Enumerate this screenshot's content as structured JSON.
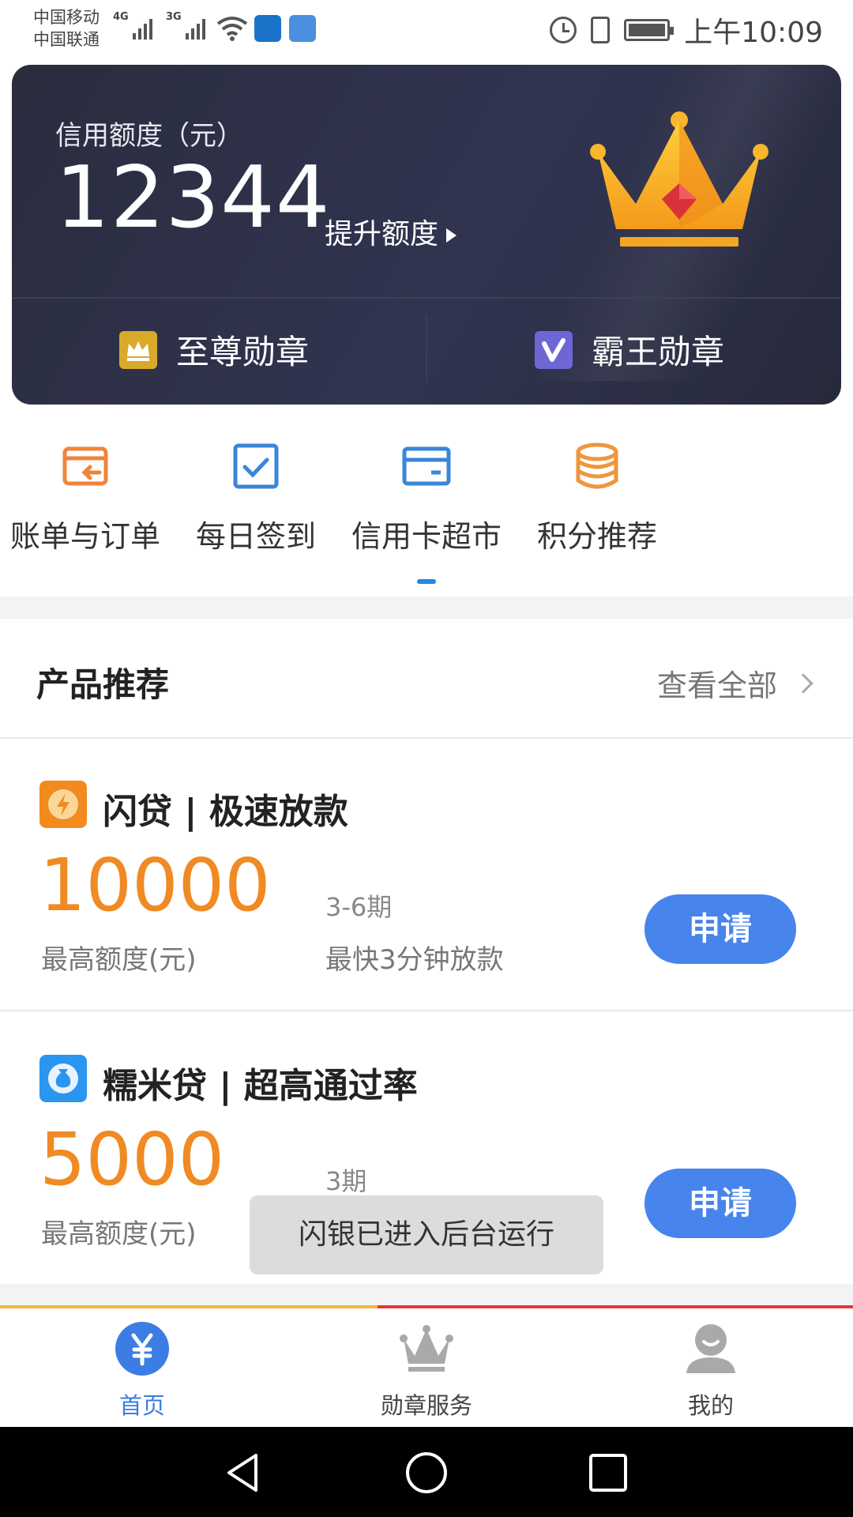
{
  "status_bar": {
    "carrier_1": "中国移动",
    "carrier_2": "中国联通",
    "sim1_network": "4G",
    "sim2_network": "3G",
    "time": "上午10:09"
  },
  "credit_card": {
    "label": "信用额度（元）",
    "amount": "12344",
    "raise_label": "提升额度",
    "badges": [
      {
        "label": "至尊勋章",
        "icon": "crown-badge-icon",
        "color": "#d9a92a"
      },
      {
        "label": "霸王勋章",
        "icon": "v-badge-icon",
        "color": "#6f66d6"
      }
    ]
  },
  "quick_tabs": [
    {
      "label": "账单与订单",
      "icon": "bill-order-icon",
      "color": "#f0843c"
    },
    {
      "label": "每日签到",
      "icon": "checkin-icon",
      "color": "#3a86d8"
    },
    {
      "label": "信用卡超市",
      "icon": "credit-card-icon",
      "color": "#3a86d8"
    },
    {
      "label": "积分推荐",
      "icon": "coins-icon",
      "color": "#f0963c"
    }
  ],
  "products": {
    "title": "产品推荐",
    "view_all": "查看全部",
    "items": [
      {
        "name": "闪贷 | 极速放款",
        "amount": "10000",
        "amount_label": "最高额度(元)",
        "term": "3-6期",
        "speed": "最快3分钟放款",
        "apply": "申请",
        "icon": "lightning-icon",
        "icon_color": "#f28a1e"
      },
      {
        "name": "糯米贷 | 超高通过率",
        "amount": "5000",
        "amount_label": "最高额度(元)",
        "term": "3期",
        "apply": "申请",
        "icon": "money-bag-icon",
        "icon_color": "#2a96f0"
      }
    ]
  },
  "toast": "闪银已进入后台运行",
  "bottom_nav": [
    {
      "label": "首页",
      "icon": "yuan-icon",
      "active": true
    },
    {
      "label": "勋章服务",
      "icon": "crown-icon",
      "active": false
    },
    {
      "label": "我的",
      "icon": "user-icon",
      "active": false
    }
  ],
  "colors": {
    "accent_blue": "#4784ec",
    "amount_orange": "#f08a24",
    "card_bg": "#2a2d3e"
  }
}
